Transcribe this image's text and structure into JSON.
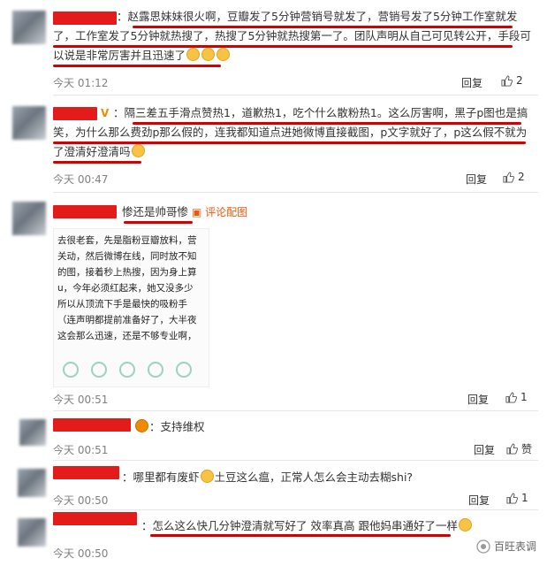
{
  "comments": [
    {
      "text_lines": [
        "：赵露思妹妹很火啊，豆瓣发了5分钟营销号就发了，营销号发了5分钟工作室就发",
        "了，工作室发了5分钟就热搜了，热搜了5分钟就热搜第一了。团队声明从自己可见转公开，手段可",
        "以说是非常厉害并且迅速了"
      ],
      "time": "今天 01:12",
      "reply": "回复",
      "likes": "2"
    },
    {
      "text_lines": [
        "：隔三差五手滑点赞热1，道歉热1，吃个什么散粉热1。这么厉害啊，黑子p图也是搞",
        "笑，为什么那么费劲p那么假的，连我都知道点进她微博直接截图，p文字就好了，p这么假不就为",
        "了澄清好澄清吗"
      ],
      "time": "今天 00:47",
      "reply": "回复",
      "likes": "2"
    },
    {
      "text": "惨还是帅哥惨",
      "pic_label": "评论配图",
      "thumbnail_lines": [
        "去很老套，先是脂粉豆瓣放料，营",
        "关动，然后微博在线，同时放不知",
        "的图，接着秒上热搜，因为身上算",
        "u，今年必须红起来，她又没多少",
        "  所以从顶流下手是最快的吸粉手",
        "（连声明都提前准备好了，大半夜",
        "这会那么迅速，还是不够专业啊，"
      ],
      "time": "今天 00:51",
      "reply": "回复",
      "likes": "1"
    },
    {
      "text": "：支持维权",
      "time": "今天 00:51",
      "reply": "回复",
      "likes": "赞"
    },
    {
      "text": "：哪里都有废虾",
      "text_after": "土豆这么瘟，正常人怎么会主动去糊shi?",
      "time": "今天 00:50",
      "reply": "回复",
      "likes": "1"
    },
    {
      "text": "：怎么这么快几分钟澄清就写好了 效率真高 跟他妈串通好了一样",
      "time": "今天 00:50"
    }
  ],
  "watermark": "百旺表调"
}
